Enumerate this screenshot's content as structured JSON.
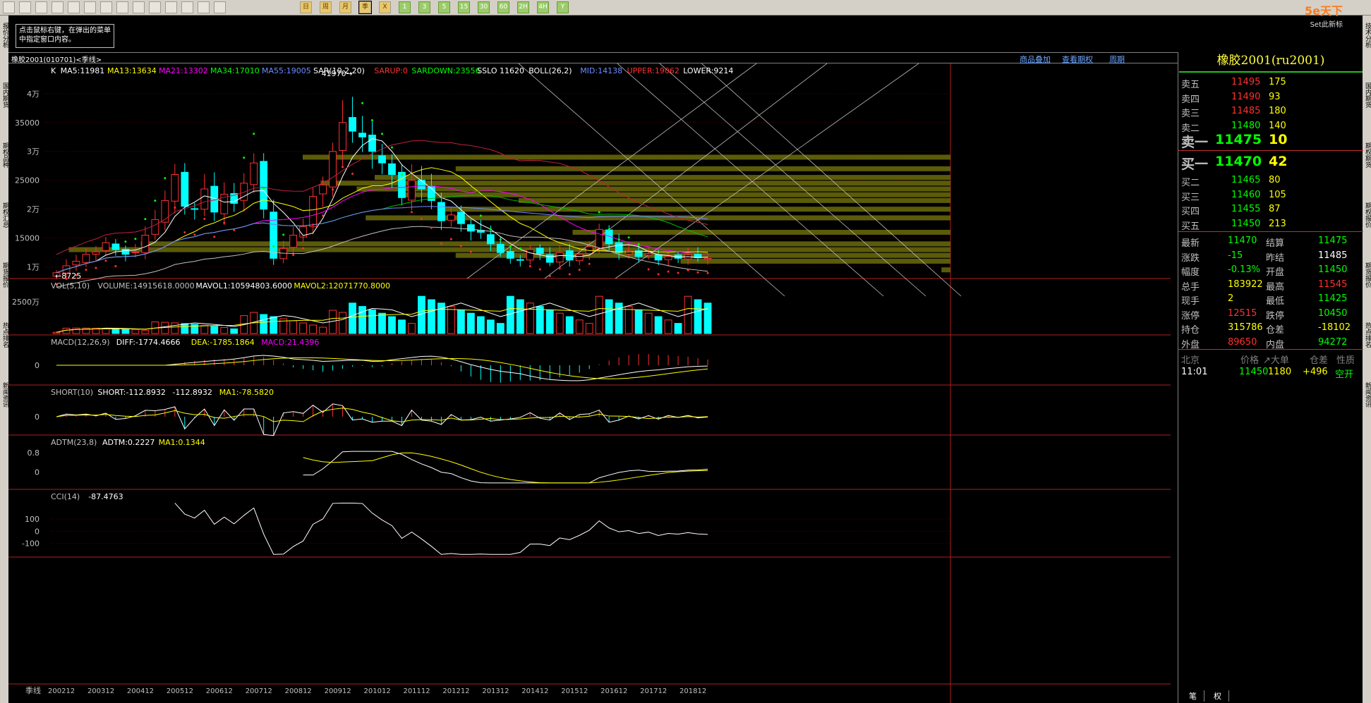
{
  "toolbar": {
    "buttons": [
      "home-icon",
      "folder-icon",
      "chart-icon",
      "refresh-icon",
      "zoom-in-icon",
      "zoom-out-icon",
      "window-icon",
      "pen-icon",
      "erase-icon",
      "filter-icon",
      "tool-icon",
      "grid-icon",
      "line-icon",
      "K-icon"
    ],
    "periods": [
      "日",
      "周",
      "月",
      "季",
      "X",
      "1",
      "3",
      "5",
      "15",
      "30",
      "60",
      "2H",
      "4H",
      "Y"
    ],
    "selected_period": "季"
  },
  "logo": {
    "text": "5e天下",
    "sub": "Set此新标"
  },
  "left_tabs": [
    "报价分析",
    "国内期货",
    "期权品种",
    "期权汇总",
    "期货报价",
    "热点排名",
    "新闻资讯"
  ],
  "right_tabs": [
    "技术分析",
    "国内期货",
    "期权期货",
    "期权报价",
    "期货报价",
    "热点排名",
    "新闻资讯"
  ],
  "tip": "点击鼠标右键，在弹出的菜单中指定窗口内容。",
  "window": {
    "title": "橡胶2001(010701)<季线>",
    "links": [
      "商品叠加",
      "查看期权",
      "周期"
    ]
  },
  "main_header": [
    {
      "t": "K",
      "c": "#ffffff"
    },
    {
      "t": "MA5:11981",
      "c": "#ffffff"
    },
    {
      "t": "MA13:13634",
      "c": "#ffff00"
    },
    {
      "t": "MA21:13302",
      "c": "#ff00ff"
    },
    {
      "t": "MA34:17010",
      "c": "#00ff00"
    },
    {
      "t": "MA55:19005",
      "c": "#6e8cff"
    },
    {
      "t": "SAR(10,2,20)",
      "c": "#ffffff"
    },
    {
      "t": "SARUP:0",
      "c": "#ff3030"
    },
    {
      "t": "SARDOWN:23556",
      "c": "#00ff00"
    },
    {
      "t": "SSLO 11620",
      "c": "#ffffff"
    },
    {
      "t": "BOLL(26,2)",
      "c": "#ffffff"
    },
    {
      "t": "MID:14138",
      "c": "#6e8cff"
    },
    {
      "t": "UPPER:19062",
      "c": "#ff3030"
    },
    {
      "t": "LOWER:9214",
      "c": "#ffffff"
    }
  ],
  "price_axis": [
    "4万",
    "35000",
    "3万",
    "25000",
    "2万",
    "15000",
    "1万"
  ],
  "annotations": {
    "high": "41970",
    "low": "8725"
  },
  "vol_header": [
    {
      "t": "VOL(5,10)",
      "c": "#c0c0c0"
    },
    {
      "t": "VOLUME:14915618.0000",
      "c": "#c0c0c0"
    },
    {
      "t": "MAVOL1:10594803.6000",
      "c": "#ffffff"
    },
    {
      "t": "MAVOL2:12071770.8000",
      "c": "#ffff00"
    }
  ],
  "vol_axis": [
    "2500万"
  ],
  "macd_header": [
    {
      "t": "MACD(12,26,9)",
      "c": "#c0c0c0"
    },
    {
      "t": "DIFF:-1774.4666",
      "c": "#ffffff"
    },
    {
      "t": "DEA:-1785.1864",
      "c": "#ffff00"
    },
    {
      "t": "MACD:21.4396",
      "c": "#ff00ff"
    }
  ],
  "macd_axis": [
    "0"
  ],
  "short_header": [
    {
      "t": "SHORT(10)",
      "c": "#c0c0c0"
    },
    {
      "t": "SHORT:-112.8932",
      "c": "#ffffff"
    },
    {
      "t": "-112.8932",
      "c": "#ffffff"
    },
    {
      "t": "MA1:-78.5820",
      "c": "#ffff00"
    }
  ],
  "short_axis": [
    "0"
  ],
  "adtm_header": [
    {
      "t": "ADTM(23,8)",
      "c": "#c0c0c0"
    },
    {
      "t": "ADTM:0.2227",
      "c": "#ffffff"
    },
    {
      "t": "MA1:0.1344",
      "c": "#ffff00"
    }
  ],
  "adtm_axis": [
    "0.8",
    "0"
  ],
  "cci_header": [
    {
      "t": "CCI(14)",
      "c": "#c0c0c0"
    },
    {
      "t": "-87.4763",
      "c": "#ffffff"
    }
  ],
  "cci_axis": [
    "100",
    "0",
    "-100"
  ],
  "x_label": "季线",
  "x_ticks": [
    "200212",
    "200312",
    "200412",
    "200512",
    "200612",
    "200712",
    "200812",
    "200912",
    "201012",
    "201112",
    "201212",
    "201312",
    "201412",
    "201512",
    "201612",
    "201712",
    "201812"
  ],
  "quote": {
    "title": "橡胶2001(ru2001)",
    "asks": [
      {
        "l": "卖五",
        "p": "11495",
        "v": "175"
      },
      {
        "l": "卖四",
        "p": "11490",
        "v": "93"
      },
      {
        "l": "卖三",
        "p": "11485",
        "v": "180"
      },
      {
        "l": "卖二",
        "p": "11480",
        "v": "140"
      },
      {
        "l": "卖一",
        "p": "11475",
        "v": "10"
      }
    ],
    "bids": [
      {
        "l": "买一",
        "p": "11470",
        "v": "42"
      },
      {
        "l": "买二",
        "p": "11465",
        "v": "80"
      },
      {
        "l": "买三",
        "p": "11460",
        "v": "105"
      },
      {
        "l": "买四",
        "p": "11455",
        "v": "87"
      },
      {
        "l": "买五",
        "p": "11450",
        "v": "213"
      }
    ],
    "stats": [
      {
        "l1": "最新",
        "v1": "11470",
        "c1": "#00ff00",
        "l2": "结算",
        "v2": "11475",
        "c2": "#00ff00"
      },
      {
        "l1": "涨跌",
        "v1": "-15",
        "c1": "#00ff00",
        "l2": "昨结",
        "v2": "11485",
        "c2": "#ffffff"
      },
      {
        "l1": "幅度",
        "v1": "-0.13%",
        "c1": "#00ff00",
        "l2": "开盘",
        "v2": "11450",
        "c2": "#00ff00"
      },
      {
        "l1": "总手",
        "v1": "183922",
        "c1": "#ffff00",
        "l2": "最高",
        "v2": "11545",
        "c2": "#ff3030"
      },
      {
        "l1": "现手",
        "v1": "2",
        "c1": "#ffff00",
        "l2": "最低",
        "v2": "11425",
        "c2": "#00ff00"
      },
      {
        "l1": "涨停",
        "v1": "12515",
        "c1": "#ff3030",
        "l2": "跌停",
        "v2": "10450",
        "c2": "#00ff00"
      },
      {
        "l1": "持仓",
        "v1": "315786",
        "c1": "#ffff00",
        "l2": "仓差",
        "v2": "-18102",
        "c2": "#ffff00"
      },
      {
        "l1": "外盘",
        "v1": "89650",
        "c1": "#ff3030",
        "l2": "内盘",
        "v2": "94272",
        "c2": "#00ff00"
      }
    ],
    "tick_header": [
      "北京",
      "价格",
      "↗大单",
      "仓差",
      "性质"
    ],
    "tick": {
      "time": "11:01",
      "price": "11450",
      "vol": "1180",
      "oi": "+496",
      "nature": "空开"
    },
    "bottom_tabs": [
      "笔",
      "权"
    ]
  },
  "chart_data": {
    "type": "candlestick",
    "title": "橡胶2001(010701)<季线>",
    "x": [
      "200212",
      "200303",
      "200306",
      "200309",
      "200312",
      "200403",
      "200406",
      "200409",
      "200412",
      "200503",
      "200506",
      "200509",
      "200512",
      "200603",
      "200606",
      "200609",
      "200612",
      "200703",
      "200706",
      "200709",
      "200712",
      "200803",
      "200806",
      "200809",
      "200812",
      "200903",
      "200906",
      "200909",
      "200912",
      "201003",
      "201006",
      "201009",
      "201012",
      "201103",
      "201106",
      "201109",
      "201112",
      "201203",
      "201206",
      "201209",
      "201212",
      "201303",
      "201306",
      "201309",
      "201312",
      "201403",
      "201406",
      "201409",
      "201412",
      "201503",
      "201506",
      "201509",
      "201512",
      "201603",
      "201606",
      "201609",
      "201612",
      "201703",
      "201706",
      "201709",
      "201712",
      "201803",
      "201806",
      "201809",
      "201812",
      "201903",
      "201906"
    ],
    "close": [
      9000,
      10200,
      11000,
      12200,
      12600,
      14200,
      13000,
      12200,
      12600,
      15500,
      18200,
      21500,
      26000,
      20500,
      20000,
      23500,
      19500,
      22600,
      21000,
      24500,
      28000,
      20000,
      11500,
      13200,
      15500,
      17000,
      22200,
      24200,
      30000,
      35000,
      33500,
      32500,
      30000,
      28000,
      26000,
      22000,
      25000,
      23500,
      21500,
      18000,
      19000,
      17500,
      16200,
      16000,
      14000,
      12500,
      11500,
      11200,
      13000,
      12300,
      10800,
      12500,
      11200,
      12200,
      13500,
      16500,
      14000,
      12500,
      12800,
      11800,
      12300,
      11200,
      11800,
      11500,
      12100,
      11600,
      11470
    ],
    "ylim": [
      8000,
      44000
    ],
    "vol_ylim": [
      0,
      35000000
    ],
    "cci_ylim": [
      -200,
      250
    ]
  }
}
